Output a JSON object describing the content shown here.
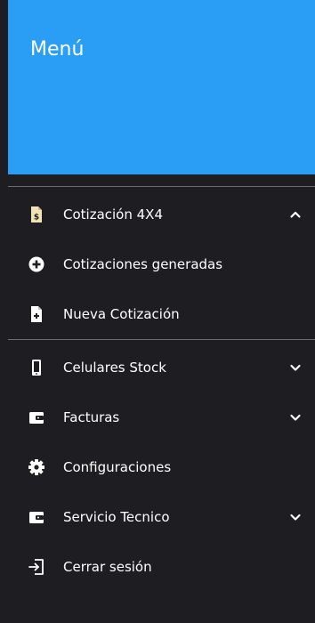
{
  "header": {
    "title": "Menú",
    "background_color": "#2a9df5"
  },
  "menu": {
    "cotizacion": {
      "label": "Cotización 4X4",
      "icon": "file-invoice-dollar-icon",
      "expanded": true,
      "children": [
        {
          "label": "Cotizaciones generadas",
          "icon": "plus-circle-icon"
        },
        {
          "label": "Nueva Cotización",
          "icon": "file-plus-icon"
        }
      ]
    },
    "items": [
      {
        "label": "Celulares Stock",
        "icon": "mobile-phone-icon",
        "expandable": true
      },
      {
        "label": "Facturas",
        "icon": "wallet-icon",
        "expandable": true
      },
      {
        "label": "Configuraciones",
        "icon": "gear-icon",
        "expandable": false
      },
      {
        "label": "Servicio Tecnico",
        "icon": "wallet-icon",
        "expandable": true
      },
      {
        "label": "Cerrar sesión",
        "icon": "sign-out-icon",
        "expandable": false
      }
    ]
  },
  "colors": {
    "drawer_background": "#1e1e22",
    "accent": "#2a9df5",
    "highlight_icon": "#f3e2b3",
    "text": "#ffffff",
    "divider": "#6b6b70"
  }
}
